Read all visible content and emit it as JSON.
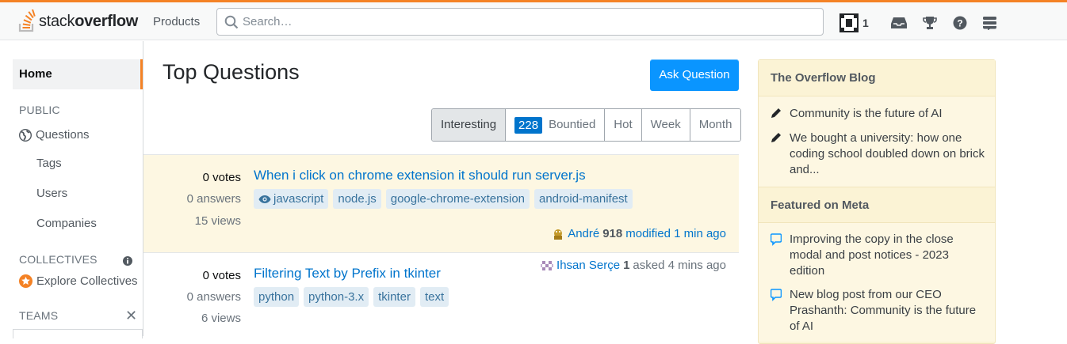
{
  "header": {
    "logo_text_light": "stack",
    "logo_text_bold": "overflow",
    "products_label": "Products",
    "search_placeholder": "Search…",
    "reputation": "1",
    "icons": [
      "achievements-icon",
      "inbox-icon",
      "trophy-icon",
      "help-icon",
      "site-switcher-icon"
    ],
    "accent": "#f48225"
  },
  "sidebar": {
    "home": "Home",
    "public_heading": "PUBLIC",
    "questions": "Questions",
    "tags": "Tags",
    "users": "Users",
    "companies": "Companies",
    "collectives_heading": "COLLECTIVES",
    "explore_collectives": "Explore Collectives",
    "teams_heading": "TEAMS"
  },
  "main": {
    "title": "Top Questions",
    "ask_button": "Ask Question",
    "filters": {
      "interesting": "Interesting",
      "bountied_count": "228",
      "bountied": "Bountied",
      "hot": "Hot",
      "week": "Week",
      "month": "Month"
    },
    "questions": [
      {
        "votes": "0 votes",
        "answers": "0 answers",
        "views": "15 views",
        "title": "When i click on chrome extension it should run server.js",
        "tags": [
          "javascript",
          "node.js",
          "google-chrome-extension",
          "android-manifest"
        ],
        "user": "André",
        "rep": "918",
        "action": "modified 1 min ago"
      },
      {
        "votes": "0 votes",
        "answers": "0 answers",
        "views": "6 views",
        "title": "Filtering Text by Prefix in tkinter",
        "tags": [
          "python",
          "python-3.x",
          "tkinter",
          "text"
        ],
        "user": "Ihsan Serçe",
        "rep": "1",
        "action": "asked 4 mins ago"
      }
    ]
  },
  "sidebar_right": {
    "blog_heading": "The Overflow Blog",
    "blog_items": [
      "Community is the future of AI",
      "We bought a university: how one coding school doubled down on brick and..."
    ],
    "meta_heading": "Featured on Meta",
    "meta_items": [
      "Improving the copy in the close modal and post notices - 2023 edition",
      "New blog post from our CEO Prashanth: Community is the future of AI"
    ]
  }
}
